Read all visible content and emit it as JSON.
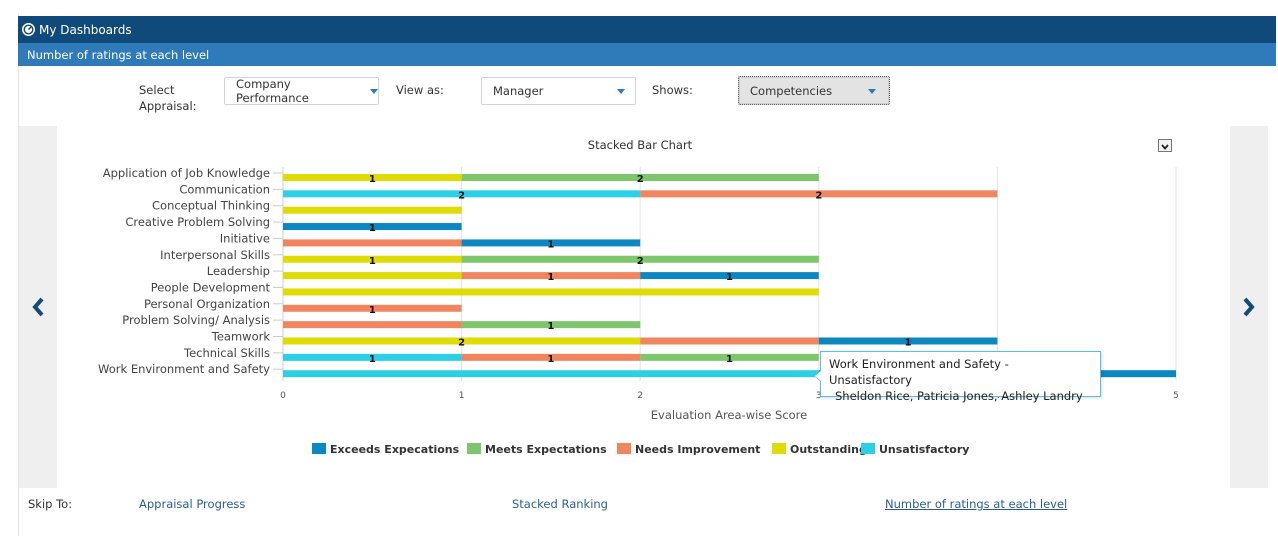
{
  "header": {
    "title": "My Dashboards",
    "icon": "dashboard-gauge-icon"
  },
  "subheader": {
    "title": "Number of ratings at each level"
  },
  "filters": {
    "appraisal_label": "Select Appraisal:",
    "appraisal_label_line1": "Select",
    "appraisal_label_line2": "Appraisal:",
    "appraisal_value": "Company Performance",
    "view_as_label": "View as:",
    "view_as_value": "Manager",
    "shows_label": "Shows:",
    "shows_value": "Competencies"
  },
  "navigation": {
    "prev_icon": "chevron-left-icon",
    "next_icon": "chevron-right-icon",
    "export_icon": "chevron-down-icon"
  },
  "tooltip": {
    "line1": "Work Environment and Safety - Unsatisfactory",
    "line2": "Sheldon Rice,  Patricia Jones,  Ashley Landry"
  },
  "skip": {
    "label": "Skip To:",
    "links": [
      "Appraisal Progress",
      "Stacked Ranking",
      "Number of ratings at each level"
    ]
  },
  "colors": {
    "Exceeds Expecations": "#0d87c2",
    "Meets Expectations": "#7dc66b",
    "Needs Improvement": "#f0865f",
    "Outstanding": "#dedb05",
    "Unsatisfactory": "#2cd0e6"
  },
  "chart_data": {
    "type": "bar",
    "orientation": "horizontal",
    "stacked": true,
    "title": "Stacked Bar Chart",
    "xlabel": "Evaluation Area-wise Score",
    "ylabel": "",
    "xlim": [
      0,
      5
    ],
    "xticks": [
      0,
      1,
      2,
      3,
      4,
      5
    ],
    "grid": true,
    "legend_position": "bottom",
    "categories": [
      "Application of Job Knowledge",
      "Communication",
      "Conceptual Thinking",
      "Creative Problem Solving",
      "Initiative",
      "Interpersonal Skills",
      "Leadership",
      "People Development",
      "Personal Organization",
      "Problem Solving/ Analysis",
      "Teamwork",
      "Technical Skills",
      "Work Environment and Safety"
    ],
    "series": [
      {
        "name": "Exceeds Expecations",
        "values": [
          0,
          0,
          0,
          1,
          1,
          0,
          1,
          0,
          0,
          0,
          1,
          0,
          2
        ]
      },
      {
        "name": "Meets Expectations",
        "values": [
          2,
          0,
          0,
          0,
          0,
          2,
          0,
          0,
          0,
          1,
          0,
          1,
          0
        ]
      },
      {
        "name": "Needs Improvement",
        "values": [
          0,
          2,
          0,
          0,
          1,
          0,
          1,
          0,
          1,
          1,
          1,
          1,
          0
        ]
      },
      {
        "name": "Outstanding",
        "values": [
          1,
          0,
          1,
          0,
          0,
          1,
          1,
          3,
          0,
          0,
          2,
          0,
          0
        ]
      },
      {
        "name": "Unsatisfactory",
        "values": [
          0,
          2,
          0,
          0,
          0,
          0,
          0,
          0,
          0,
          0,
          0,
          1,
          3
        ]
      }
    ],
    "bar_order": [
      [
        [
          "Outstanding",
          1
        ],
        [
          "Meets Expectations",
          2
        ]
      ],
      [
        [
          "Unsatisfactory",
          2
        ],
        [
          "Needs Improvement",
          2
        ]
      ],
      [
        [
          "Outstanding",
          1
        ]
      ],
      [
        [
          "Exceeds Expecations",
          1
        ]
      ],
      [
        [
          "Needs Improvement",
          1
        ],
        [
          "Exceeds Expecations",
          1
        ]
      ],
      [
        [
          "Outstanding",
          1
        ],
        [
          "Meets Expectations",
          2
        ]
      ],
      [
        [
          "Outstanding",
          1
        ],
        [
          "Needs Improvement",
          1
        ],
        [
          "Exceeds Expecations",
          1
        ]
      ],
      [
        [
          "Outstanding",
          3
        ]
      ],
      [
        [
          "Needs Improvement",
          1
        ]
      ],
      [
        [
          "Needs Improvement",
          1
        ],
        [
          "Meets Expectations",
          1
        ]
      ],
      [
        [
          "Outstanding",
          2
        ],
        [
          "Needs Improvement",
          1
        ],
        [
          "Exceeds Expecations",
          1
        ]
      ],
      [
        [
          "Unsatisfactory",
          1
        ],
        [
          "Needs Improvement",
          1
        ],
        [
          "Meets Expectations",
          1
        ]
      ],
      [
        [
          "Unsatisfactory",
          3
        ],
        [
          "Exceeds Expecations",
          2
        ]
      ]
    ],
    "data_labels": [
      [
        "1",
        "2"
      ],
      [
        "2",
        "2"
      ],
      [
        ""
      ],
      [
        "1"
      ],
      [
        "",
        "1"
      ],
      [
        "1",
        "2"
      ],
      [
        "",
        "1",
        "1"
      ],
      [
        ""
      ],
      [
        "1"
      ],
      [
        "",
        "1"
      ],
      [
        "2",
        "",
        "1"
      ],
      [
        "1",
        "1",
        "1"
      ],
      [
        "",
        ""
      ]
    ]
  }
}
